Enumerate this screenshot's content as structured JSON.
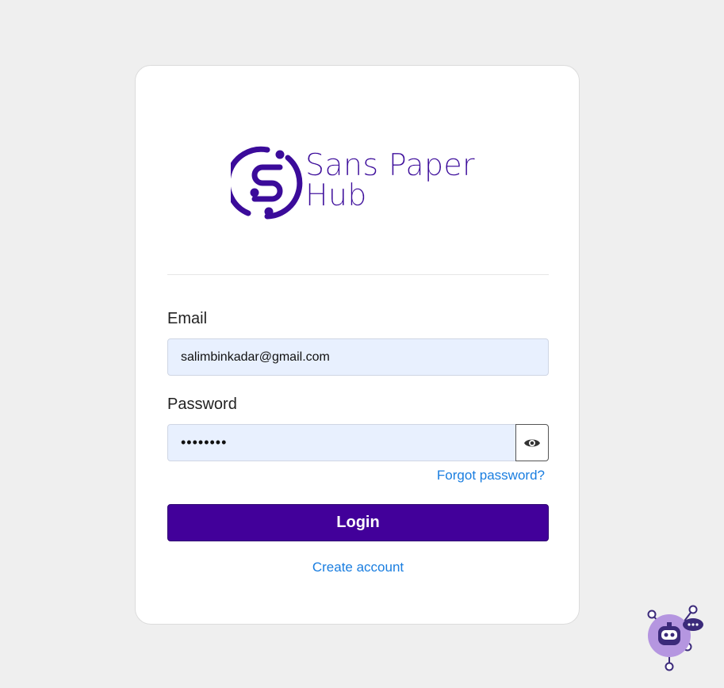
{
  "brand": {
    "name_line1": "Sans Paper",
    "name_line2": "Hub",
    "color": "#3b0b9a"
  },
  "form": {
    "email_label": "Email",
    "email_value": "salimbinkadar@gmail.com",
    "password_label": "Password",
    "password_value": "••••••••",
    "show_password_icon": "eye-icon",
    "forgot_link": "Forgot password?",
    "login_label": "Login",
    "create_account_link": "Create account"
  },
  "colors": {
    "accent": "#42009a",
    "link": "#1a7ee0",
    "input_bg": "#e8f0fe",
    "page_bg": "#efefef"
  },
  "widgets": {
    "chat_bot_icon": "chat-bot-icon"
  }
}
